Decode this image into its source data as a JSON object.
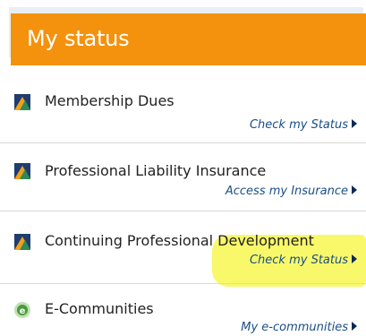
{
  "colors": {
    "accent": "#f4920d",
    "link": "#1a4f86",
    "highlight": "#f8f86a"
  },
  "header": {
    "title": "My status"
  },
  "items": [
    {
      "title": "Membership Dues",
      "link": "Check my Status",
      "icon": "membership-dues-icon"
    },
    {
      "title": "Professional Liability Insurance",
      "link": "Access my Insurance",
      "icon": "insurance-icon"
    },
    {
      "title": "Continuing Professional Development",
      "link": "Check my Status",
      "icon": "cpd-icon"
    },
    {
      "title": "E-Communities",
      "link": "My e-communities",
      "icon": "e-communities-icon"
    }
  ]
}
